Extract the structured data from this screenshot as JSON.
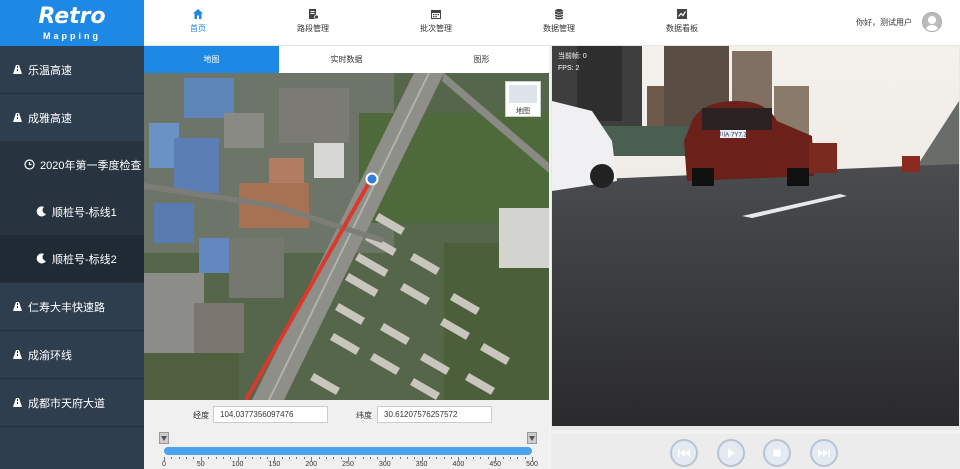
{
  "logo": {
    "line1": "Retro",
    "line2": "Mapping"
  },
  "sidebar": {
    "items": [
      {
        "label": "乐温高速",
        "level": 0
      },
      {
        "label": "成雅高速",
        "level": 0
      },
      {
        "label": "2020年第一季度检查",
        "level": 1
      },
      {
        "label": "顺桩号-标线1",
        "level": 2
      },
      {
        "label": "顺桩号-标线2",
        "level": 2,
        "active": true
      },
      {
        "label": "仁寿大丰快速路",
        "level": 0
      },
      {
        "label": "成渝环线",
        "level": 0
      },
      {
        "label": "成都市天府大道",
        "level": 0
      }
    ]
  },
  "topnav": {
    "items": [
      {
        "label": "首页",
        "icon": "home-icon",
        "active": true
      },
      {
        "label": "路段管理",
        "icon": "road-doc-icon"
      },
      {
        "label": "批次管理",
        "icon": "calendar-icon"
      },
      {
        "label": "数据管理",
        "icon": "database-icon"
      },
      {
        "label": "数据看板",
        "icon": "chart-board-icon"
      }
    ],
    "greeting": "你好，测试用户"
  },
  "tabs": [
    {
      "label": "地图",
      "active": true
    },
    {
      "label": "实时数据"
    },
    {
      "label": "图形"
    }
  ],
  "map": {
    "type_toggle": "地图"
  },
  "coords": {
    "lng_label": "经度",
    "lng_value": "104.0377356097476",
    "lat_label": "纬度",
    "lat_value": "30.61207576257572"
  },
  "slider": {
    "min": 0,
    "max": 500,
    "labels": [
      "0",
      "50",
      "100",
      "150",
      "200",
      "250",
      "300",
      "350",
      "400",
      "450",
      "500"
    ]
  },
  "video": {
    "frame_label": "当前帧: 0",
    "fps_label": "FPS: 2",
    "plate": "川A·7Y7.3"
  },
  "controls": [
    "skip-back-icon",
    "play-icon",
    "stop-icon",
    "skip-forward-icon"
  ],
  "colors": {
    "accent": "#1e88e5",
    "sidebar": "#2f3e4e",
    "track": "#d93a2b"
  }
}
